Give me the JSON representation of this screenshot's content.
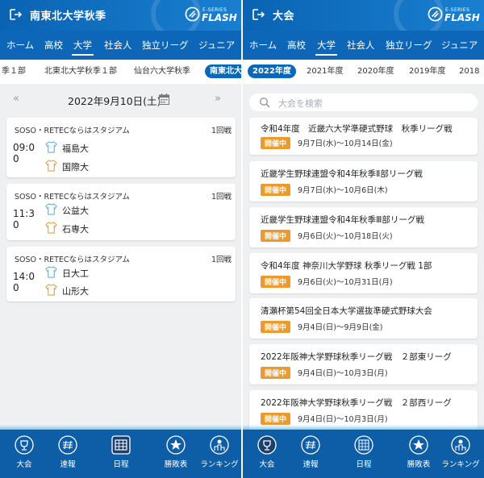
{
  "left": {
    "header": {
      "title": "南東北大学秋季"
    },
    "brand": {
      "small": "E-SERIES",
      "big": "FLASH"
    },
    "tabs": [
      "ホーム",
      "高校",
      "大学",
      "社会人",
      "独立リーグ",
      "ジュニア"
    ],
    "active_tab": "大学",
    "league_tabs": [
      "季１部",
      "北東北大学秋季１部",
      "仙台六大学秋季",
      "南東北大"
    ],
    "active_league": "南東北大",
    "date_nav": {
      "prev": "«",
      "date": "2022年9月10日(土)",
      "next": "»",
      "calendar_icon": "calendar-icon"
    },
    "games": [
      {
        "venue": "SOSO・RETECならはスタジアム",
        "round": "1回戦",
        "time": "09:0 0",
        "home": "福島大",
        "away": "国際大"
      },
      {
        "venue": "SOSO・RETECならはスタジアム",
        "round": "1回戦",
        "time": "11:3 0",
        "home": "公益大",
        "away": "石専大"
      },
      {
        "venue": "SOSO・RETECならはスタジアム",
        "round": "1回戦",
        "time": "14:0 0",
        "home": "日大工",
        "away": "山形大"
      }
    ],
    "bottom_nav": [
      "大会",
      "速報",
      "日程",
      "勝敗表",
      "ランキング"
    ],
    "active_nav": "日程"
  },
  "right": {
    "header": {
      "title": "大会"
    },
    "brand": {
      "small": "E-SERIES",
      "big": "FLASH"
    },
    "tabs": [
      "ホーム",
      "高校",
      "大学",
      "社会人",
      "独立リーグ",
      "ジュニア"
    ],
    "active_tab": "大学",
    "year_tabs": [
      "2022年度",
      "2021年度",
      "2020年度",
      "2019年度",
      "2018"
    ],
    "active_year": "2022年度",
    "search": {
      "placeholder": "大会を検索"
    },
    "tournaments": [
      {
        "name": "令和4年度　近畿六大学準硬式野球　秋季リーグ戦",
        "status": "開催中",
        "period": "9月7日(水)〜10月14日(金)"
      },
      {
        "name": "近畿学生野球連盟令和4年秋季Ⅱ部リーグ戦",
        "status": "開催中",
        "period": "9月7日(水)〜10月6日(木)"
      },
      {
        "name": "近畿学生野球連盟令和4年秋季Ⅲ部リーグ戦",
        "status": "開催中",
        "period": "9月6日(火)〜10月18日(火)"
      },
      {
        "name": "令和4年度 神奈川大学野球 秋季リーグ戦 1部",
        "status": "開催中",
        "period": "9月6日(火)〜10月31日(月)"
      },
      {
        "name": "清瀬杯第54回全日本大学選抜準硬式野球大会",
        "status": "開催中",
        "period": "9月4日(日)〜9月9日(金)"
      },
      {
        "name": "2022年阪神大学野球秋季リーグ戦　２部東リーグ",
        "status": "開催中",
        "period": "9月4日(日)〜10月3日(月)"
      },
      {
        "name": "2022年阪神大学野球秋季リーグ戦　２部西リーグ",
        "status": "開催中",
        "period": "9月4日(日)〜10月3日(月)"
      }
    ],
    "bottom_nav": [
      "大会",
      "速報",
      "日程",
      "勝敗表",
      "ランキング"
    ],
    "active_nav": "大会"
  },
  "colors": {
    "header": "#0a63b3",
    "tabbar": "#0d66b8",
    "bottom_nav": "#0d5ea6",
    "badge": "#ec9a2d",
    "pill": "#0a68b8"
  }
}
